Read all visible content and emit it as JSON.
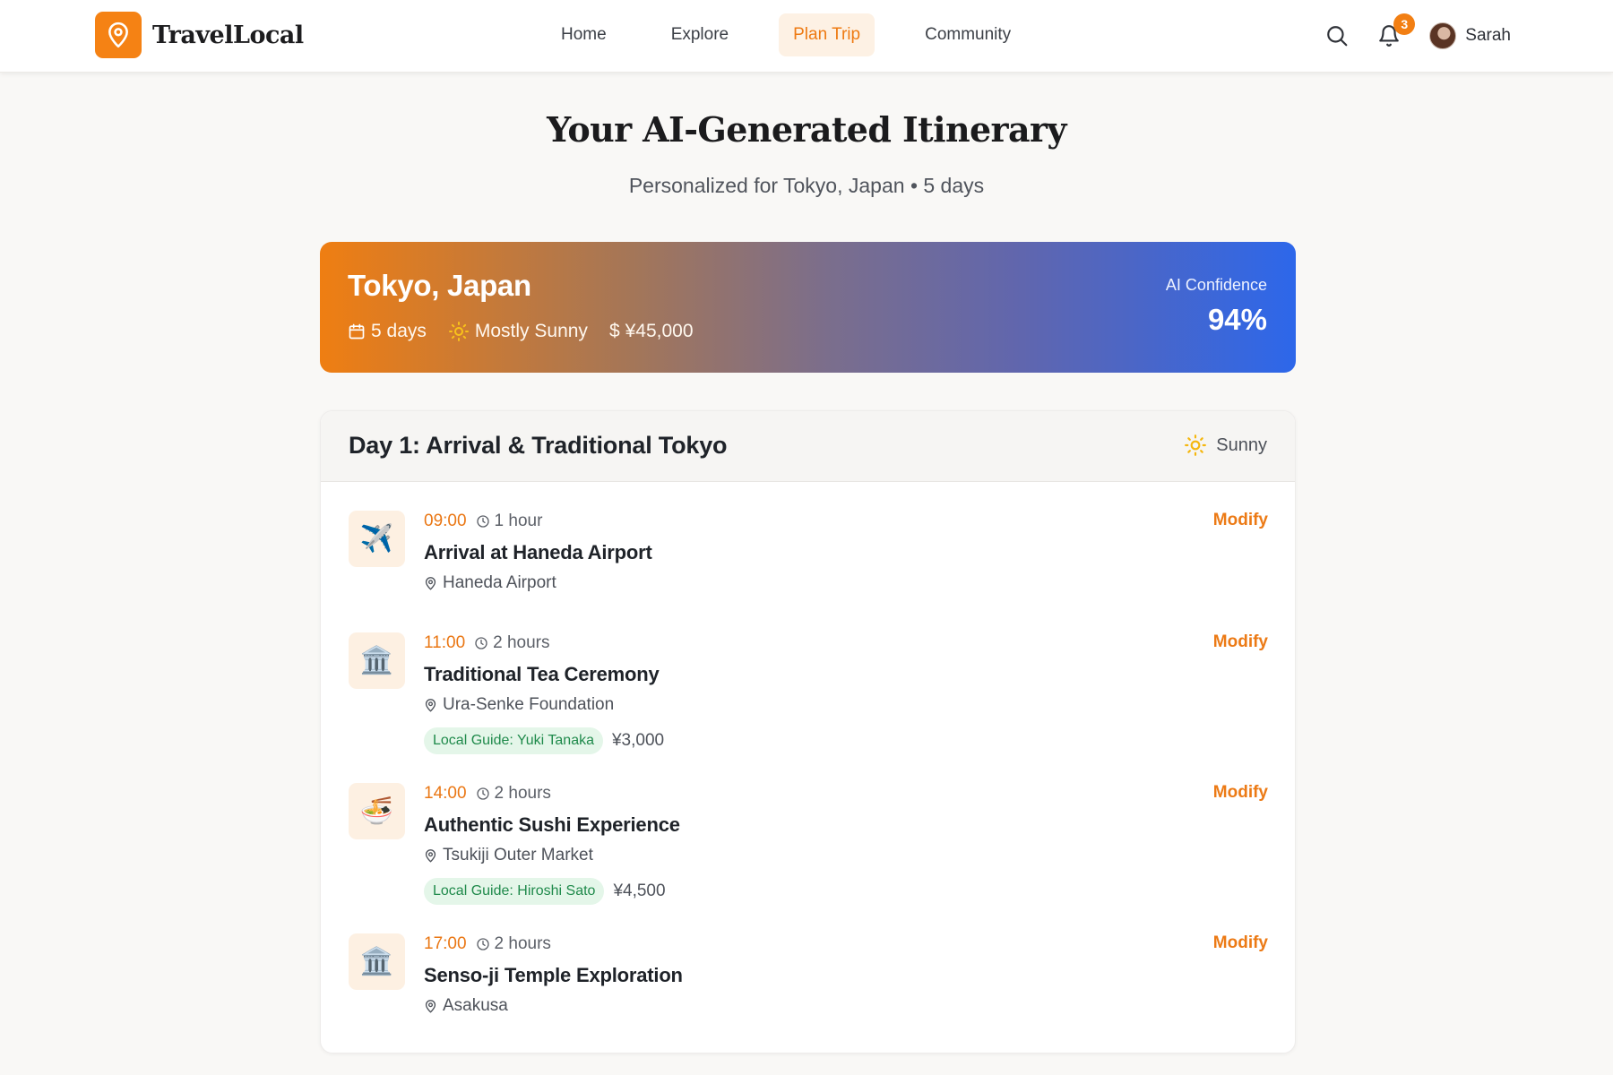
{
  "brand": {
    "name": "TravelLocal",
    "accent": "#f58214"
  },
  "nav": {
    "items": [
      {
        "label": "Home",
        "active": false
      },
      {
        "label": "Explore",
        "active": false
      },
      {
        "label": "Plan Trip",
        "active": true
      },
      {
        "label": "Community",
        "active": false
      }
    ]
  },
  "header": {
    "search_icon": "search-icon",
    "notification_count": "3",
    "user_name": "Sarah"
  },
  "page": {
    "title": "Your AI-Generated Itinerary",
    "subtitle": "Personalized for Tokyo, Japan • 5 days"
  },
  "summary": {
    "city": "Tokyo, Japan",
    "duration": "5 days",
    "weather": "Mostly Sunny",
    "budget": "¥45,000",
    "confidence_label": "AI Confidence",
    "confidence_value": "94%",
    "gradient_start": "#ef7e12",
    "gradient_end": "#2d67ea"
  },
  "day": {
    "title": "Day 1: Arrival & Traditional Tokyo",
    "weather": "Sunny",
    "activities": [
      {
        "icon": "airplane-icon",
        "time": "09:00",
        "duration": "1 hour",
        "title": "Arrival at Haneda Airport",
        "location": "Haneda Airport",
        "guide": "",
        "price": "",
        "action": "Modify"
      },
      {
        "icon": "museum-icon",
        "time": "11:00",
        "duration": "2 hours",
        "title": "Traditional Tea Ceremony",
        "location": "Ura-Senke Foundation",
        "guide": "Local Guide: Yuki Tanaka",
        "price": "¥3,000",
        "action": "Modify"
      },
      {
        "icon": "noodle-bowl-icon",
        "time": "14:00",
        "duration": "2 hours",
        "title": "Authentic Sushi Experience",
        "location": "Tsukiji Outer Market",
        "guide": "Local Guide: Hiroshi Sato",
        "price": "¥4,500",
        "action": "Modify"
      },
      {
        "icon": "museum-icon",
        "time": "17:00",
        "duration": "2 hours",
        "title": "Senso-ji Temple Exploration",
        "location": "Asakusa",
        "guide": "",
        "price": "",
        "action": "Modify"
      }
    ]
  }
}
